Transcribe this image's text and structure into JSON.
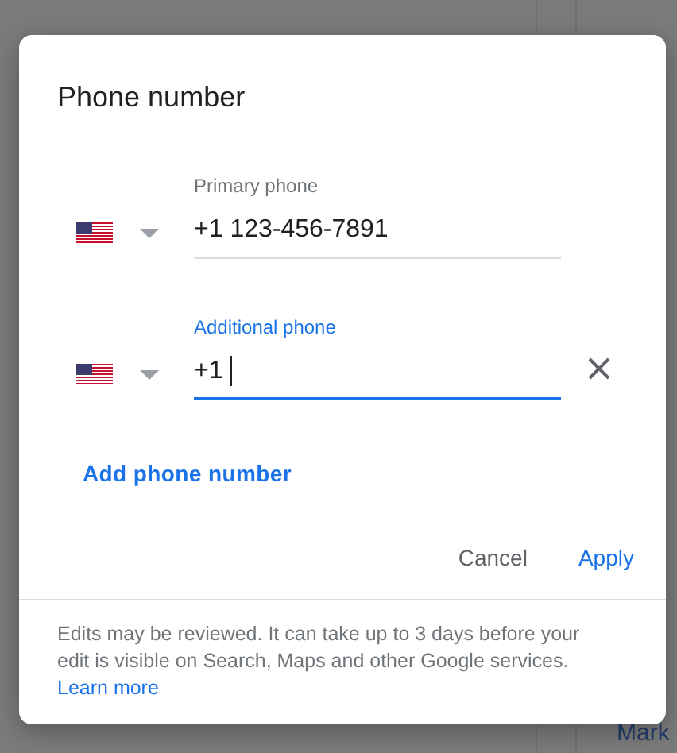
{
  "background": {
    "link": "Mark"
  },
  "dialog": {
    "title": "Phone number",
    "phones": [
      {
        "label": "Primary phone",
        "value": "+1 123-456-7891",
        "focused": false,
        "clearable": false
      },
      {
        "label": "Additional phone",
        "value": "+1 ",
        "focused": true,
        "clearable": true
      }
    ],
    "add_link": "Add phone number",
    "buttons": [
      {
        "label": "Cancel",
        "kind": "secondary"
      },
      {
        "label": "Apply",
        "kind": "primary"
      }
    ],
    "footer": {
      "text": "Edits may be reviewed. It can take up to 3 days before your edit is visible on Search, Maps and other Google services.",
      "link": "Learn more"
    }
  }
}
